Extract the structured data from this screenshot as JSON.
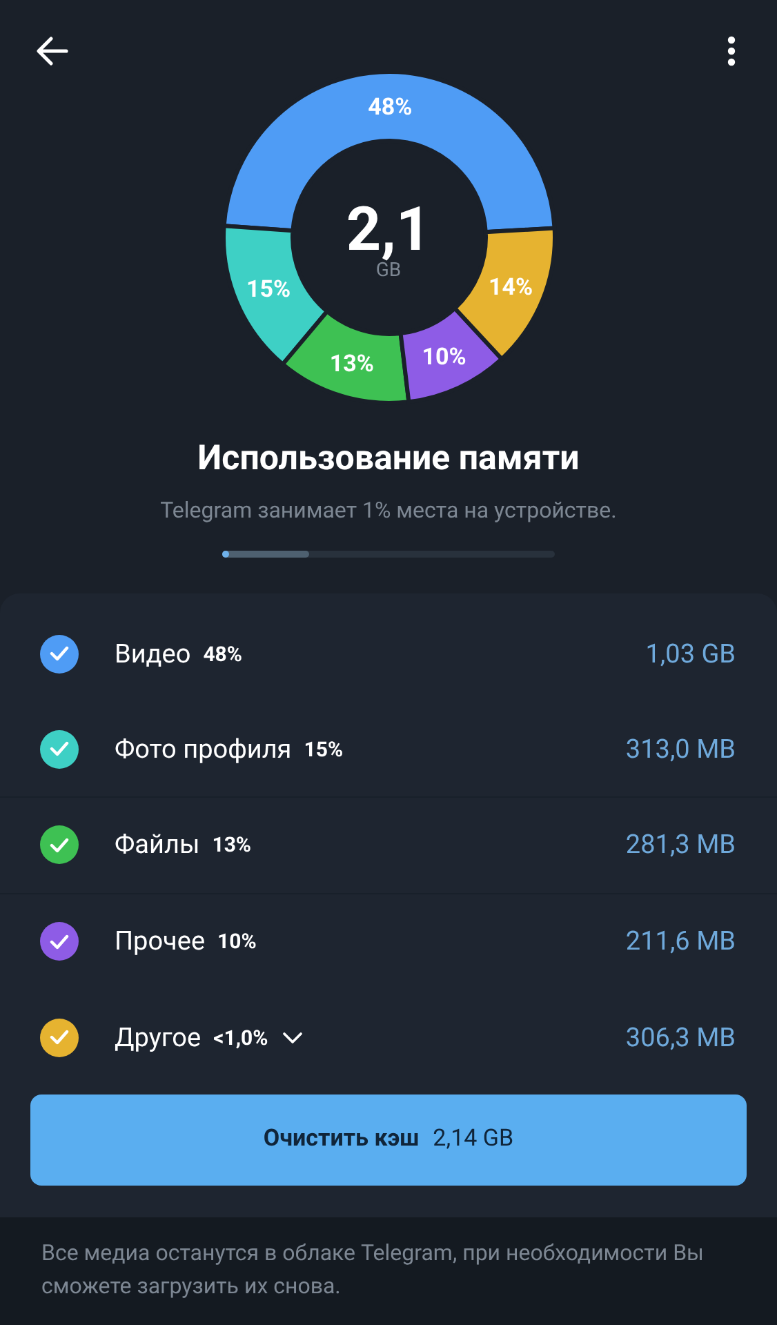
{
  "chart": {
    "total": "2,1",
    "unit": "GB",
    "chart_data": {
      "type": "donut",
      "values": [
        48,
        15,
        13,
        10,
        14
      ],
      "value_labels": [
        "48%",
        "15%",
        "13%",
        "10%",
        "14%"
      ]
    }
  },
  "title": "Использование памяти",
  "subtitle": "Telegram занимает 1% места на устройстве.",
  "usage_bar": {
    "level": 0.26
  },
  "rows": [
    {
      "label": "Видео",
      "percent": "48%",
      "size": "1,03 GB",
      "checked": true,
      "color": "#4f9cf5"
    },
    {
      "label": "Фото профиля",
      "percent": "15%",
      "size": "313,0 MB",
      "checked": true,
      "color": "#3ed0c5"
    },
    {
      "label": "Файлы",
      "percent": "13%",
      "size": "281,3 MB",
      "checked": true,
      "color": "#3ec153"
    },
    {
      "label": "Прочее",
      "percent": "10%",
      "size": "211,6 MB",
      "checked": true,
      "color": "#8e5ce6"
    },
    {
      "label": "Другое",
      "percent": "<1,0%",
      "size": "306,3 MB",
      "checked": true,
      "color": "#e6b330",
      "expandable": true
    }
  ],
  "clear_button": {
    "label": "Очистить кэш",
    "size": "2,14 GB"
  },
  "footer": "Все медиа останутся в облаке Telegram, при необходимости Вы сможете загрузить их снова."
}
